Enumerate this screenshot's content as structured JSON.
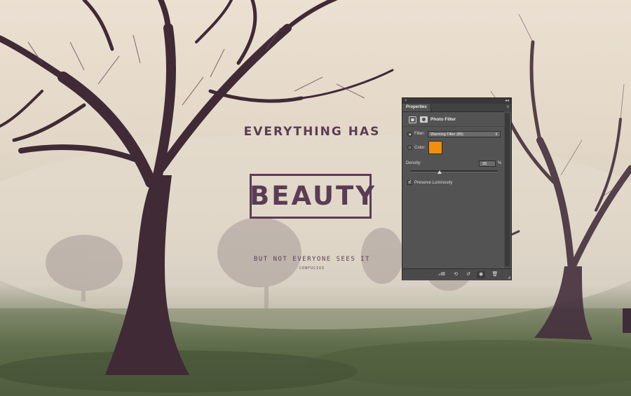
{
  "poster": {
    "headline_top": "EVERYTHING HAS",
    "headline_main": "BEAUTY",
    "subline": "BUT NOT EVERYONE SEES IT",
    "author": "CONFUCIUS"
  },
  "panel": {
    "tab_label": "Properties",
    "close_glyph": "×",
    "collapse_glyph": "◂◂",
    "menu_glyph": "≡",
    "adjustment_title": "Photo Filter",
    "filter_label": "Filter:",
    "filter_value": "Warming Filter (85)",
    "color_label": "Color:",
    "color_swatch": "#f0900a",
    "density_label": "Density:",
    "density_value": "33",
    "density_unit": "%",
    "density_level": 0.33,
    "preserve_label": "Preserve Luminosity",
    "preserve_checked": true,
    "filter_selected": true
  },
  "icons": {
    "header": [
      "adjustment-layer-icon",
      "mask-icon"
    ],
    "bottom": [
      "clip-to-layer-icon",
      "view-previous-state-icon",
      "reset-icon",
      "toggle-visibility-icon",
      "delete-icon"
    ]
  },
  "colors": {
    "accent_text": "#5a3d55",
    "panel_bg": "#535353"
  }
}
